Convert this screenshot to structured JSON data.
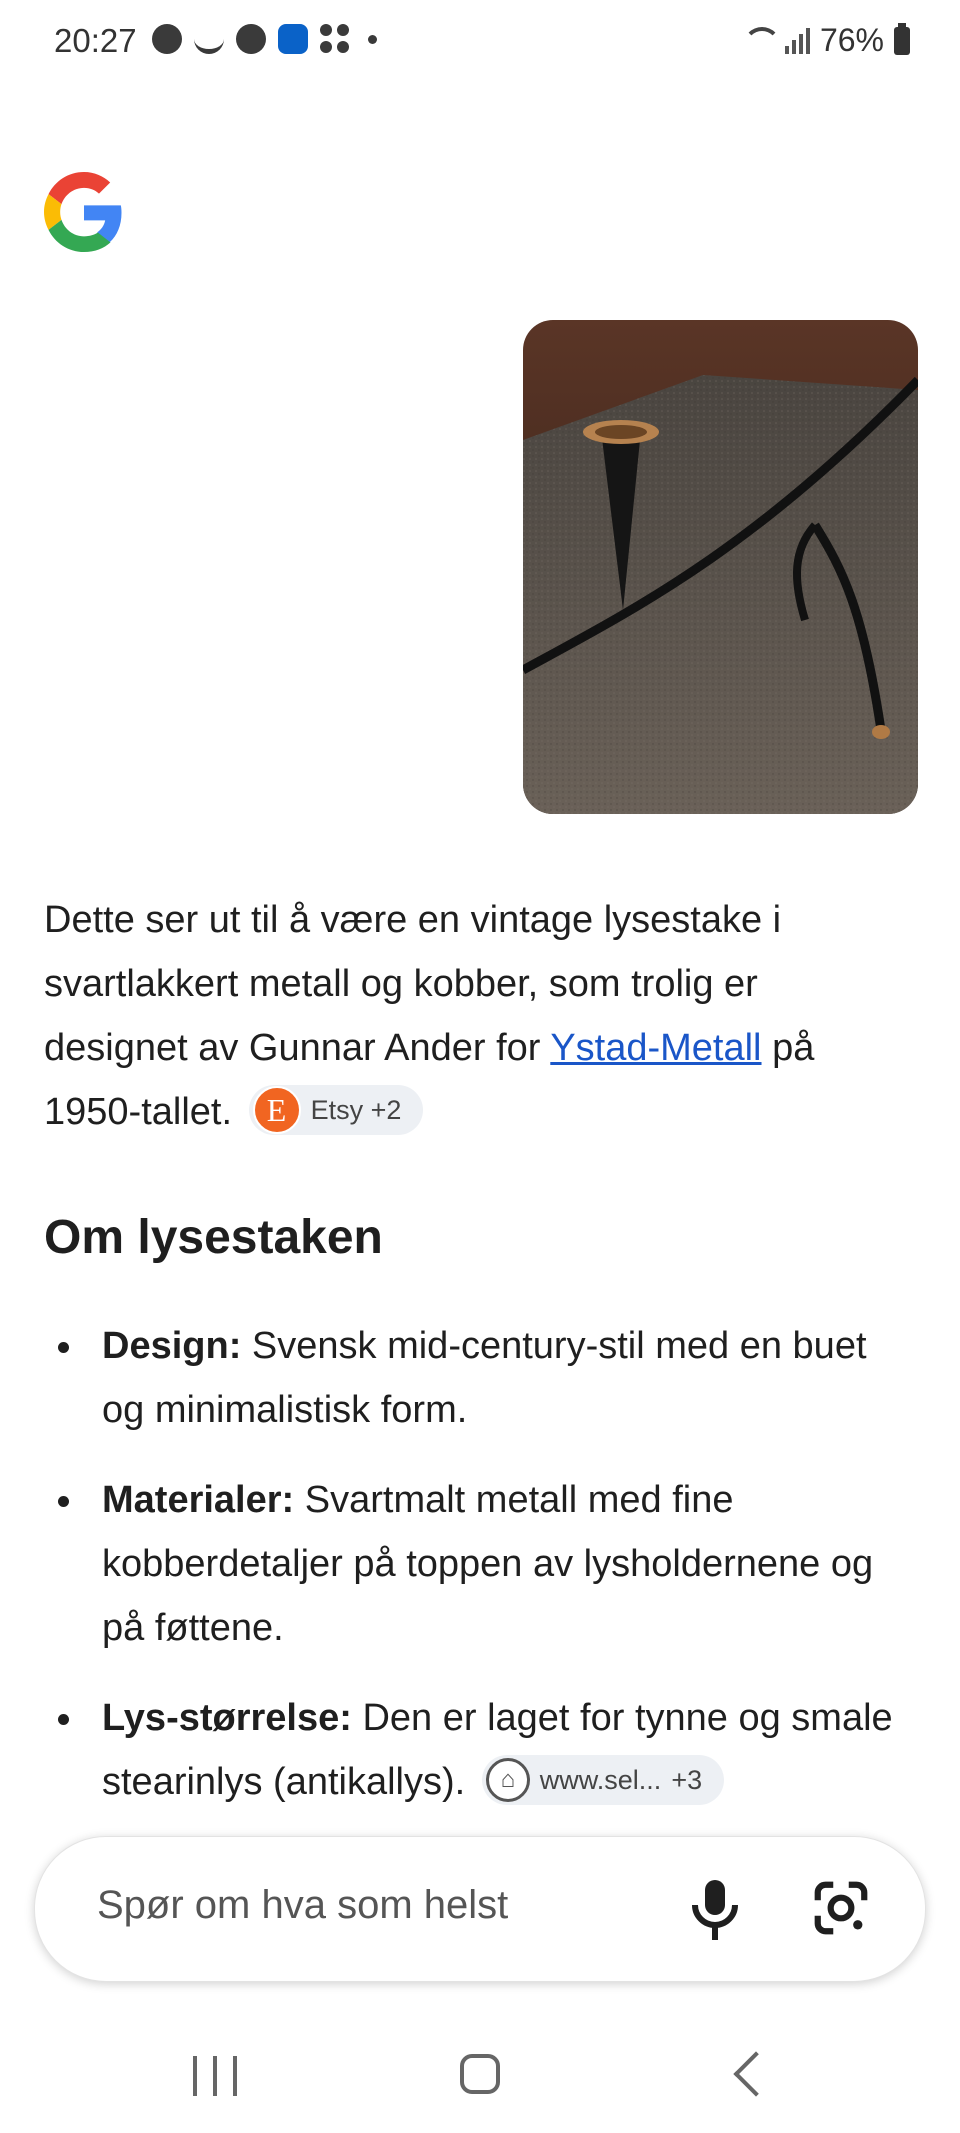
{
  "status_bar": {
    "time": "20:27",
    "battery": "76%",
    "icons": [
      "facebook-icon",
      "smile-icon",
      "clock-icon",
      "app-icon",
      "grid-icon",
      "wifi-icon",
      "signal-icon",
      "battery-icon"
    ]
  },
  "answer": {
    "text_before_link": "Dette ser ut til å være en vintage lysestake i svartlakkert metall og kobber, som trolig er designet av Gunnar Ander for ",
    "link_text": "Ystad-Metall",
    "text_after_link": " på 1950-tallet.",
    "source_chip": {
      "logo_letter": "E",
      "label": "Etsy +2"
    }
  },
  "section": {
    "heading": "Om lysestaken",
    "bullets": [
      {
        "label": "Design:",
        "text": " Svensk mid-century-stil med en buet og minimalistisk form."
      },
      {
        "label": "Materialer:",
        "text": " Svartmalt metall med fine kobberdetaljer på toppen av lysholdernene og på føttene."
      },
      {
        "label": "Lys-størrelse:",
        "text": " Den er laget for tynne og smale stearinlys (antikallys).",
        "source_chip": {
          "label": "www.sel...",
          "count": "+3"
        }
      }
    ]
  },
  "input": {
    "placeholder": "Spør om hva som helst"
  },
  "colors": {
    "link": "#1a56c8",
    "chip_bg": "#edf0f4",
    "etsy_orange": "#f16521"
  }
}
